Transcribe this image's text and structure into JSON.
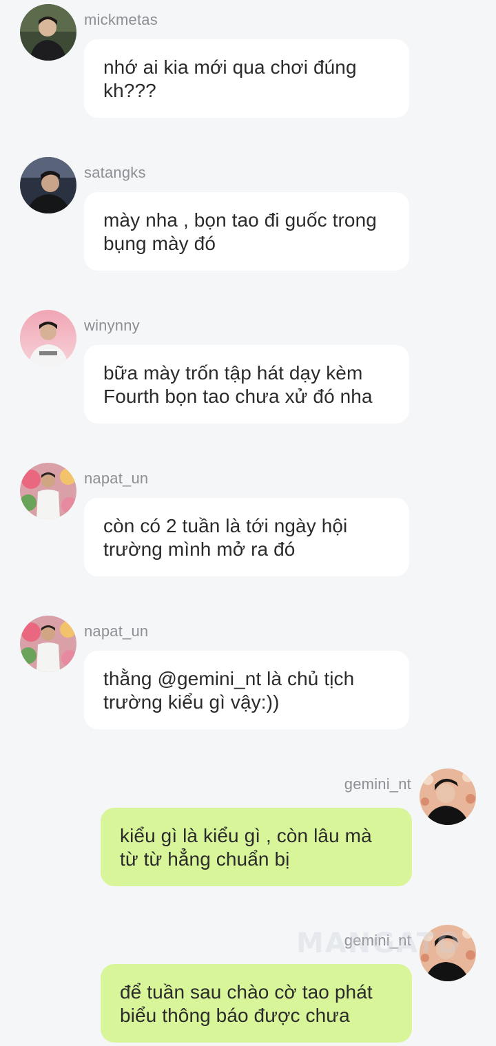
{
  "messages": [
    {
      "username": "mickmetas",
      "text": "nhớ ai kia mới qua chơi đúng kh???",
      "avatar_icon": "user-avatar-mickmetas"
    },
    {
      "username": "satangks",
      "text": "mày nha , bọn tao đi guốc trong bụng mày đó",
      "avatar_icon": "user-avatar-satangks"
    },
    {
      "username": "winynny",
      "text": "bữa mày trốn tập hát dạy kèm Fourth bọn tao chưa xử đó nha",
      "avatar_icon": "user-avatar-winynny"
    },
    {
      "username": "napat_un",
      "text": "còn có 2 tuần là tới ngày hội trường mình mở ra đó",
      "avatar_icon": "user-avatar-napat-un"
    },
    {
      "username": "napat_un",
      "text": "thằng @gemini_nt là chủ tịch trường kiểu gì vậy:))",
      "avatar_icon": "user-avatar-napat-un"
    },
    {
      "username": "gemini_nt",
      "text": "kiểu gì là kiểu gì , còn lâu mà từ từ hẳng chuẩn bị",
      "avatar_icon": "user-avatar-gemini-nt"
    },
    {
      "username": "gemini_nt",
      "text": "để tuần sau chào cờ tao phát biểu thông báo được chưa",
      "avatar_icon": "user-avatar-gemini-nt"
    }
  ],
  "watermark": "MANGATO",
  "colors": {
    "background": "#f5f6f8",
    "incoming_bubble": "#ffffff",
    "outgoing_bubble": "#d9f59a",
    "username": "#8d8f94",
    "text": "#2b2b2b"
  }
}
